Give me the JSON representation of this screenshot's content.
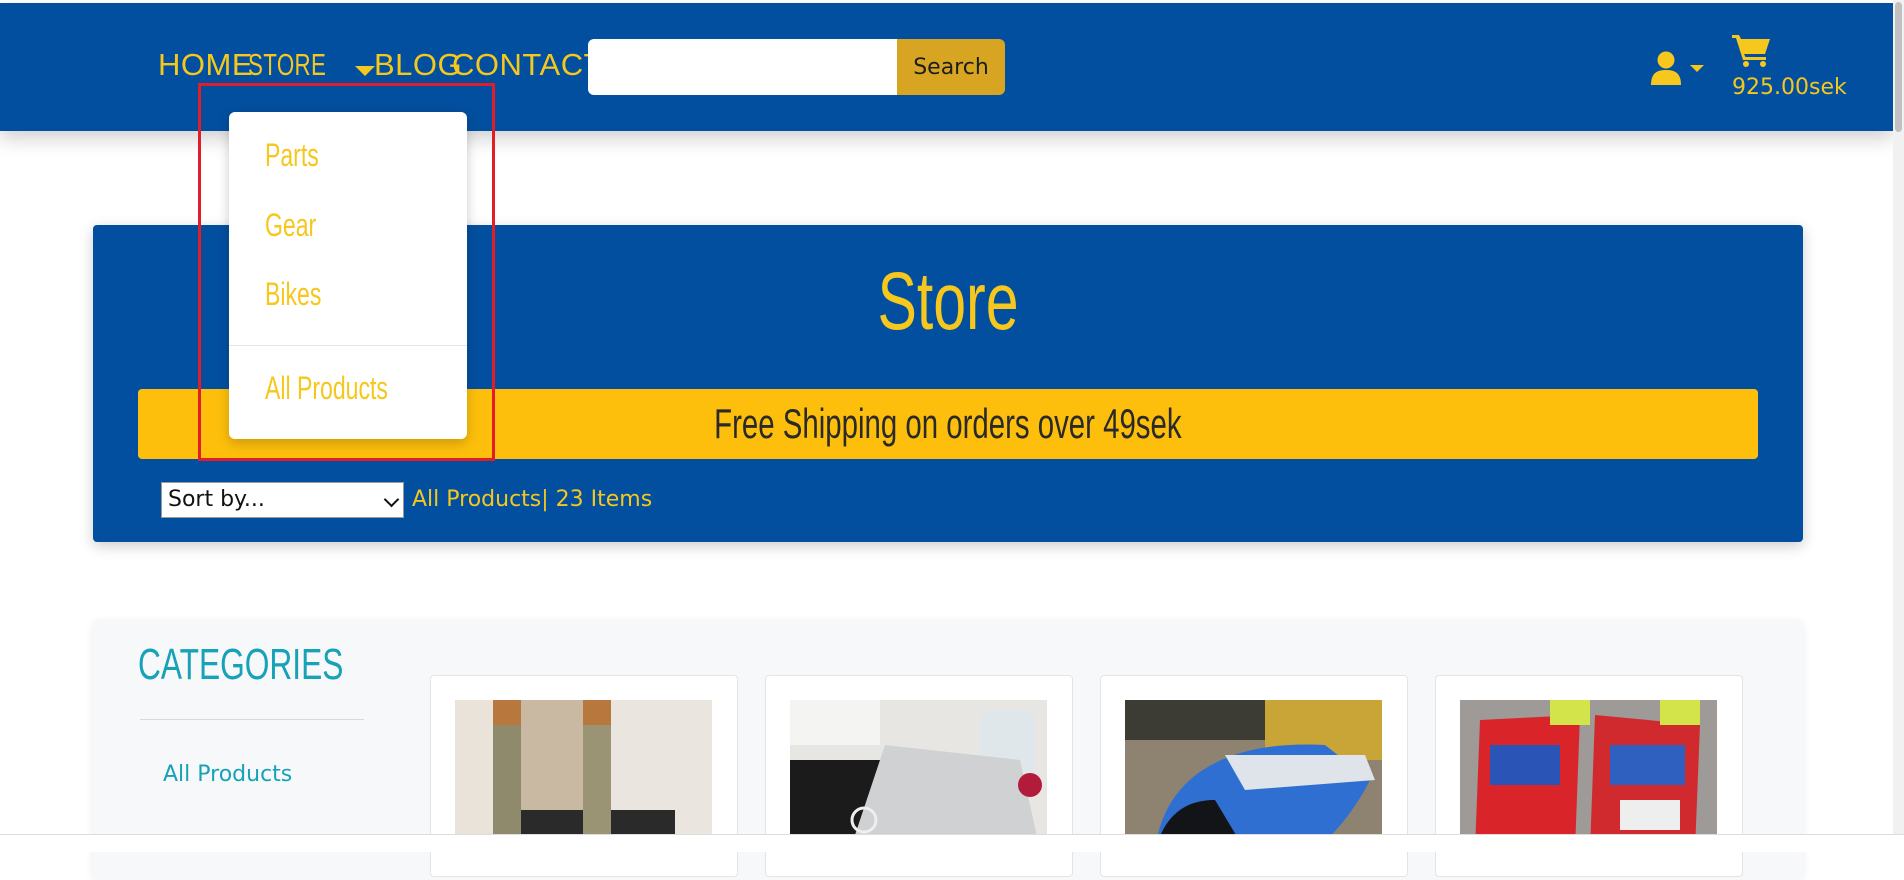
{
  "nav": {
    "links": [
      "HOME",
      "STORE",
      "BLOG",
      "CONTACT"
    ],
    "search_value": "",
    "search_button": "Search",
    "cart_amount": "925.00sek"
  },
  "dropdown": {
    "items": [
      "Parts",
      "Gear",
      "Bikes"
    ],
    "all_products": "All Products"
  },
  "hero": {
    "title": "Store",
    "shipping_banner": "Free Shipping on orders over 49sek",
    "sort_selected": "Sort by...",
    "item_count": "All Products| 23 Items"
  },
  "sidebar": {
    "title": "CATEGORIES",
    "links": [
      "All Products"
    ]
  },
  "colors": {
    "navy": "#034f9f",
    "yellow": "#f6c71c",
    "banner": "#fdbf0b",
    "teal": "#17a2b8",
    "highlight": "#e11d2a"
  }
}
